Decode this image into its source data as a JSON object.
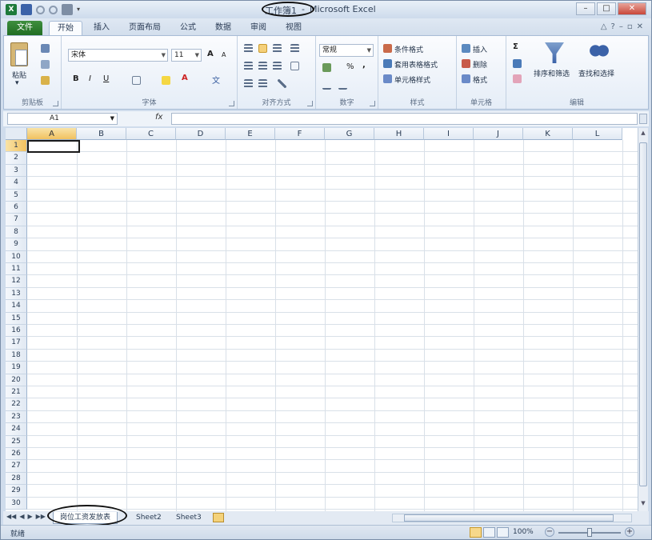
{
  "window": {
    "title_doc": "工作簿1",
    "title_sep": "-",
    "title_app": "Microsoft Excel",
    "minimize": "–",
    "maximize": "□",
    "close": "✕"
  },
  "tabs": [
    "文件",
    "开始",
    "插入",
    "页面布局",
    "公式",
    "数据",
    "审阅",
    "视图"
  ],
  "ribbon": {
    "clipboard": {
      "label": "剪贴板",
      "paste": "粘贴"
    },
    "font": {
      "label": "字体",
      "name": "宋体",
      "size": "11",
      "grow": "A",
      "shrink": "A",
      "bold": "B",
      "italic": "I",
      "underline": "U"
    },
    "alignment": {
      "label": "对齐方式"
    },
    "number": {
      "label": "数字",
      "format": "常规",
      "percent": "%",
      "comma": ","
    },
    "styles": {
      "label": "样式",
      "conditional": "条件格式",
      "table": "套用表格格式",
      "cell": "单元格样式"
    },
    "cells": {
      "label": "单元格",
      "insert": "插入",
      "delete": "删除",
      "format": "格式"
    },
    "editing": {
      "label": "编辑",
      "sum": "Σ",
      "sort": "排序和筛选",
      "find": "查找和选择"
    }
  },
  "formula_bar": {
    "name_box": "A1",
    "fx": "fx",
    "formula": ""
  },
  "grid": {
    "columns": [
      "A",
      "B",
      "C",
      "D",
      "E",
      "F",
      "G",
      "H",
      "I",
      "J",
      "K",
      "L"
    ],
    "rows": [
      "1",
      "2",
      "3",
      "4",
      "5",
      "6",
      "7",
      "8",
      "9",
      "10",
      "11",
      "12",
      "13",
      "14",
      "15",
      "16",
      "17",
      "18",
      "19",
      "20",
      "21",
      "22",
      "23",
      "24",
      "25",
      "26",
      "27",
      "28",
      "29",
      "30"
    ],
    "active_cell": "A1"
  },
  "sheets": [
    "岗位工资发放表",
    "Sheet2",
    "Sheet3"
  ],
  "status": {
    "ready": "就绪",
    "zoom": "100%",
    "minus": "−",
    "plus": "+"
  },
  "colors": {
    "file_tab": "#1f6b21",
    "selection_header": "#f1c15f",
    "gridline": "#d9e0e8"
  }
}
